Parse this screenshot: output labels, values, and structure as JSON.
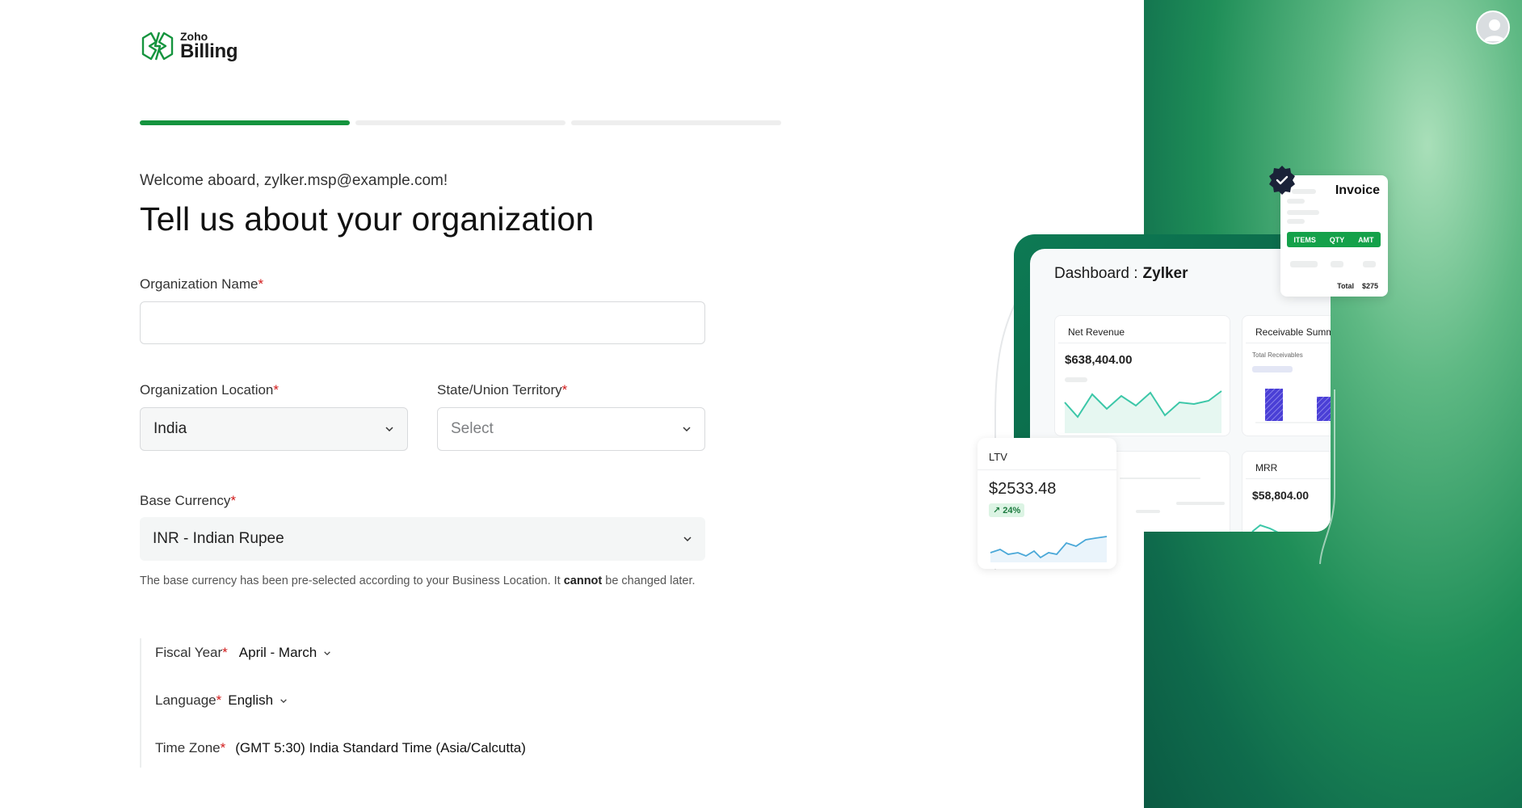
{
  "brand": {
    "company": "Zoho",
    "product": "Billing",
    "color": "#15943e"
  },
  "progress": {
    "total_steps": 3,
    "completed_steps": 1
  },
  "header": {
    "welcome": "Welcome aboard, zylker.msp@example.com!",
    "title": "Tell us about your organization"
  },
  "form": {
    "org_name": {
      "label": "Organization Name",
      "value": ""
    },
    "org_location": {
      "label": "Organization Location",
      "value": "India"
    },
    "state": {
      "label": "State/Union Territory",
      "placeholder": "Select"
    },
    "currency": {
      "label": "Base Currency",
      "value": "INR - Indian Rupee"
    },
    "help_before": "The base currency has been pre-selected according to your Business Location. It ",
    "help_bold": "cannot",
    "help_after": " be changed later.",
    "required_mark": "*"
  },
  "meta": {
    "fiscal_year": {
      "label": "Fiscal Year",
      "value": "April - March"
    },
    "language": {
      "label": "Language",
      "value": "English"
    },
    "time_zone": {
      "label": "Time Zone",
      "value": "(GMT 5:30) India Standard Time (Asia/Calcutta)"
    }
  },
  "illustration": {
    "dashboard_label": "Dashboard :",
    "dashboard_org": "Zylker",
    "net_revenue": {
      "label": "Net Revenue",
      "value": "$638,404.00"
    },
    "receivable": {
      "label": "Receivable Summ",
      "sub": "Total Receivables"
    },
    "mrr": {
      "label": "MRR",
      "value": "$58,804.00"
    },
    "ltv": {
      "label": "LTV",
      "value": "$2533.48",
      "change": "↗ 24%"
    },
    "invoice": {
      "title": "Invoice",
      "columns": [
        "ITEMS",
        "QTY",
        "AMT"
      ],
      "total_label": "Total",
      "total_value": "$275"
    }
  },
  "icons": {
    "avatar": "user-avatar-icon",
    "chevron": "chevron-down-icon",
    "verified": "verified-check-icon"
  }
}
